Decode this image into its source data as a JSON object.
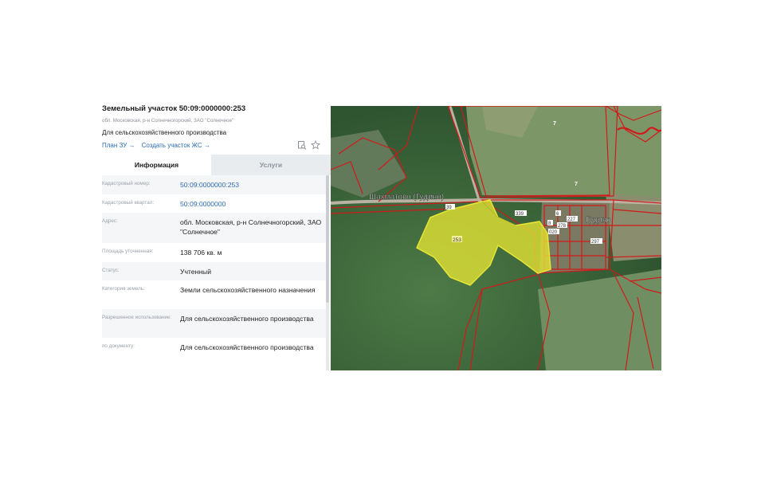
{
  "parcel": {
    "title": "Земельный участок 50:09:0000000:253",
    "address_short": "обл. Московская, р-н Солнечногорский, ЗАО \"Солнечное\"",
    "purpose": "Для сельскохозяйственного производства"
  },
  "links": {
    "plan": "План ЗУ →",
    "create": "Создать участок ЖС →"
  },
  "tools": {
    "zoom_icon": "search-document-icon",
    "favorite_icon": "star-icon"
  },
  "tabs": {
    "info": "Информация",
    "services": "Услуги"
  },
  "info": [
    {
      "label": "Кадастровый номер:",
      "value": "50:09:0000000:253",
      "link": true
    },
    {
      "label": "Кадастровый квартал:",
      "value": "50:09:0000000",
      "link": true
    },
    {
      "label": "Адрес:",
      "value": "обл. Московская, р-н Солнечногорский, ЗАО \"Солнечное\"",
      "link": false
    },
    {
      "label": "Площадь уточненная:",
      "value": "138 706 кв. м",
      "link": false
    },
    {
      "label": "Статус:",
      "value": "Учтенный",
      "link": false
    },
    {
      "label": "Категория земель:",
      "value": "Земли сельскохозяйственного назначения",
      "link": false
    },
    {
      "label": "Разрешенное использование:",
      "value": "Для сельскохозяйственного производства",
      "link": false
    },
    {
      "label": "по документу:",
      "value": "Для сельскохозяйственного производства",
      "link": false
    }
  ],
  "map": {
    "village_1": "Шахматово (Гудино)",
    "village_2": "Гудино",
    "parcel_label": "253",
    "neighbor_labels": [
      "7",
      "7",
      "39",
      "339",
      "297",
      "6",
      "8",
      "227",
      "020",
      "278"
    ],
    "colors": {
      "boundary": "#d11a1a",
      "selected_fill": "#e6e633",
      "forest": "#3f6a3c",
      "field": "#7f9a6a"
    }
  }
}
